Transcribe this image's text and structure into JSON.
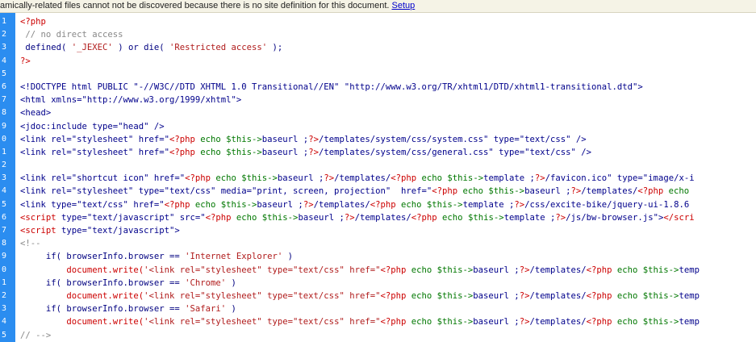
{
  "infobar": {
    "message": "amically-related files cannot not be discovered because there is no site definition for this document.",
    "link_label": "Setup"
  },
  "colors": {
    "gutter": "#2b8df0",
    "php_delim": "#cc0000",
    "comment": "#888888",
    "string": "#b01b1b",
    "tag": "#00008b",
    "php_code": "#007700"
  },
  "lines": [
    {
      "n": "1",
      "segs": [
        [
          "php",
          "<?php"
        ]
      ]
    },
    {
      "n": "2",
      "segs": [
        [
          "comment",
          " // no direct access"
        ]
      ]
    },
    {
      "n": "3",
      "segs": [
        [
          "fn",
          " defined( "
        ],
        [
          "str",
          "'_JEXEC'"
        ],
        [
          "fn",
          " ) or die( "
        ],
        [
          "str",
          "'Restricted access'"
        ],
        [
          "fn",
          " );"
        ]
      ]
    },
    {
      "n": "4",
      "segs": [
        [
          "php",
          "?>"
        ]
      ]
    },
    {
      "n": "5",
      "segs": []
    },
    {
      "n": "6",
      "segs": [
        [
          "tag",
          "<!DOCTYPE html PUBLIC \"-//W3C//DTD XHTML 1.0 Transitional//EN\" \"http://www.w3.org/TR/xhtml1/DTD/xhtml1-transitional.dtd\">"
        ]
      ]
    },
    {
      "n": "7",
      "segs": [
        [
          "tag",
          "<html xmlns=\"http://www.w3.org/1999/xhtml\">"
        ]
      ]
    },
    {
      "n": "8",
      "segs": [
        [
          "tag",
          "<head>"
        ]
      ]
    },
    {
      "n": "9",
      "segs": [
        [
          "tag",
          "<jdoc:include type=\"head\" />"
        ]
      ]
    },
    {
      "n": "0",
      "segs": [
        [
          "tag",
          "<link rel=\"stylesheet\" href=\""
        ],
        [
          "php",
          "<?php"
        ],
        [
          "phpcode",
          " echo $this->"
        ],
        [
          "tag",
          "baseurl ;"
        ],
        [
          "php",
          "?>"
        ],
        [
          "tag",
          "/templates/system/css/system.css\" type=\"text/css\" />"
        ]
      ]
    },
    {
      "n": "1",
      "segs": [
        [
          "tag",
          "<link rel=\"stylesheet\" href=\""
        ],
        [
          "php",
          "<?php"
        ],
        [
          "phpcode",
          " echo $this->"
        ],
        [
          "tag",
          "baseurl ;"
        ],
        [
          "php",
          "?>"
        ],
        [
          "tag",
          "/templates/system/css/general.css\" type=\"text/css\" />"
        ]
      ]
    },
    {
      "n": "2",
      "segs": []
    },
    {
      "n": "3",
      "segs": [
        [
          "tag",
          "<link rel=\"shortcut icon\" href=\""
        ],
        [
          "php",
          "<?php"
        ],
        [
          "phpcode",
          " echo $this->"
        ],
        [
          "tag",
          "baseurl ;"
        ],
        [
          "php",
          "?>"
        ],
        [
          "tag",
          "/templates/"
        ],
        [
          "php",
          "<?php"
        ],
        [
          "phpcode",
          " echo $this->"
        ],
        [
          "tag",
          "template ;"
        ],
        [
          "php",
          "?>"
        ],
        [
          "tag",
          "/favicon.ico\" type=\"image/x-i"
        ]
      ]
    },
    {
      "n": "4",
      "segs": [
        [
          "tag",
          "<link rel=\"stylesheet\" type=\"text/css\" media=\"print, screen, projection\"  href=\""
        ],
        [
          "php",
          "<?php"
        ],
        [
          "phpcode",
          " echo $this->"
        ],
        [
          "tag",
          "baseurl ;"
        ],
        [
          "php",
          "?>"
        ],
        [
          "tag",
          "/templates/"
        ],
        [
          "php",
          "<?php"
        ],
        [
          "phpcode",
          " echo"
        ]
      ]
    },
    {
      "n": "5",
      "segs": [
        [
          "tag",
          "<link type=\"text/css\" href=\""
        ],
        [
          "php",
          "<?php"
        ],
        [
          "phpcode",
          " echo $this->"
        ],
        [
          "tag",
          "baseurl ;"
        ],
        [
          "php",
          "?>"
        ],
        [
          "tag",
          "/templates/"
        ],
        [
          "php",
          "<?php"
        ],
        [
          "phpcode",
          " echo $this->"
        ],
        [
          "tag",
          "template ;"
        ],
        [
          "php",
          "?>"
        ],
        [
          "tag",
          "/css/excite-bike/jquery-ui-1.8.6"
        ]
      ]
    },
    {
      "n": "6",
      "segs": [
        [
          "php",
          "<script"
        ],
        [
          "tag",
          " type=\"text/javascript\" src=\""
        ],
        [
          "php",
          "<?php"
        ],
        [
          "phpcode",
          " echo $this->"
        ],
        [
          "tag",
          "baseurl ;"
        ],
        [
          "php",
          "?>"
        ],
        [
          "tag",
          "/templates/"
        ],
        [
          "php",
          "<?php"
        ],
        [
          "phpcode",
          " echo $this->"
        ],
        [
          "tag",
          "template ;"
        ],
        [
          "php",
          "?>"
        ],
        [
          "tag",
          "/js/bw-browser.js\">"
        ],
        [
          "php",
          "</scri"
        ]
      ]
    },
    {
      "n": "7",
      "segs": [
        [
          "php",
          "<script"
        ],
        [
          "tag",
          " type=\"text/javascript\">"
        ]
      ]
    },
    {
      "n": "8",
      "segs": [
        [
          "comment",
          "<!--"
        ]
      ]
    },
    {
      "n": "9",
      "segs": [
        [
          "fn",
          "     if( browserInfo.browser == "
        ],
        [
          "str",
          "'Internet Explorer'"
        ],
        [
          "fn",
          " )"
        ]
      ]
    },
    {
      "n": "0",
      "segs": [
        [
          "fn",
          "         "
        ],
        [
          "php",
          "document.write("
        ],
        [
          "str",
          "'<link rel=\"stylesheet\" type=\"text/css\" href=\""
        ],
        [
          "php",
          "<?php"
        ],
        [
          "phpcode",
          " echo $this->"
        ],
        [
          "tag",
          "baseurl ;"
        ],
        [
          "php",
          "?>"
        ],
        [
          "tag",
          "/templates/"
        ],
        [
          "php",
          "<?php"
        ],
        [
          "phpcode",
          " echo $this->"
        ],
        [
          "tag",
          "temp"
        ]
      ]
    },
    {
      "n": "1",
      "segs": [
        [
          "fn",
          "     if( browserInfo.browser == "
        ],
        [
          "str",
          "'Chrome'"
        ],
        [
          "fn",
          " )"
        ]
      ]
    },
    {
      "n": "2",
      "segs": [
        [
          "fn",
          "         "
        ],
        [
          "php",
          "document.write("
        ],
        [
          "str",
          "'<link rel=\"stylesheet\" type=\"text/css\" href=\""
        ],
        [
          "php",
          "<?php"
        ],
        [
          "phpcode",
          " echo $this->"
        ],
        [
          "tag",
          "baseurl ;"
        ],
        [
          "php",
          "?>"
        ],
        [
          "tag",
          "/templates/"
        ],
        [
          "php",
          "<?php"
        ],
        [
          "phpcode",
          " echo $this->"
        ],
        [
          "tag",
          "temp"
        ]
      ]
    },
    {
      "n": "3",
      "segs": [
        [
          "fn",
          "     if( browserInfo.browser == "
        ],
        [
          "str",
          "'Safari'"
        ],
        [
          "fn",
          " )"
        ]
      ]
    },
    {
      "n": "4",
      "segs": [
        [
          "fn",
          "         "
        ],
        [
          "php",
          "document.write("
        ],
        [
          "str",
          "'<link rel=\"stylesheet\" type=\"text/css\" href=\""
        ],
        [
          "php",
          "<?php"
        ],
        [
          "phpcode",
          " echo $this->"
        ],
        [
          "tag",
          "baseurl ;"
        ],
        [
          "php",
          "?>"
        ],
        [
          "tag",
          "/templates/"
        ],
        [
          "php",
          "<?php"
        ],
        [
          "phpcode",
          " echo $this->"
        ],
        [
          "tag",
          "temp"
        ]
      ]
    },
    {
      "n": "5",
      "segs": [
        [
          "comment",
          "// -->"
        ]
      ]
    }
  ]
}
